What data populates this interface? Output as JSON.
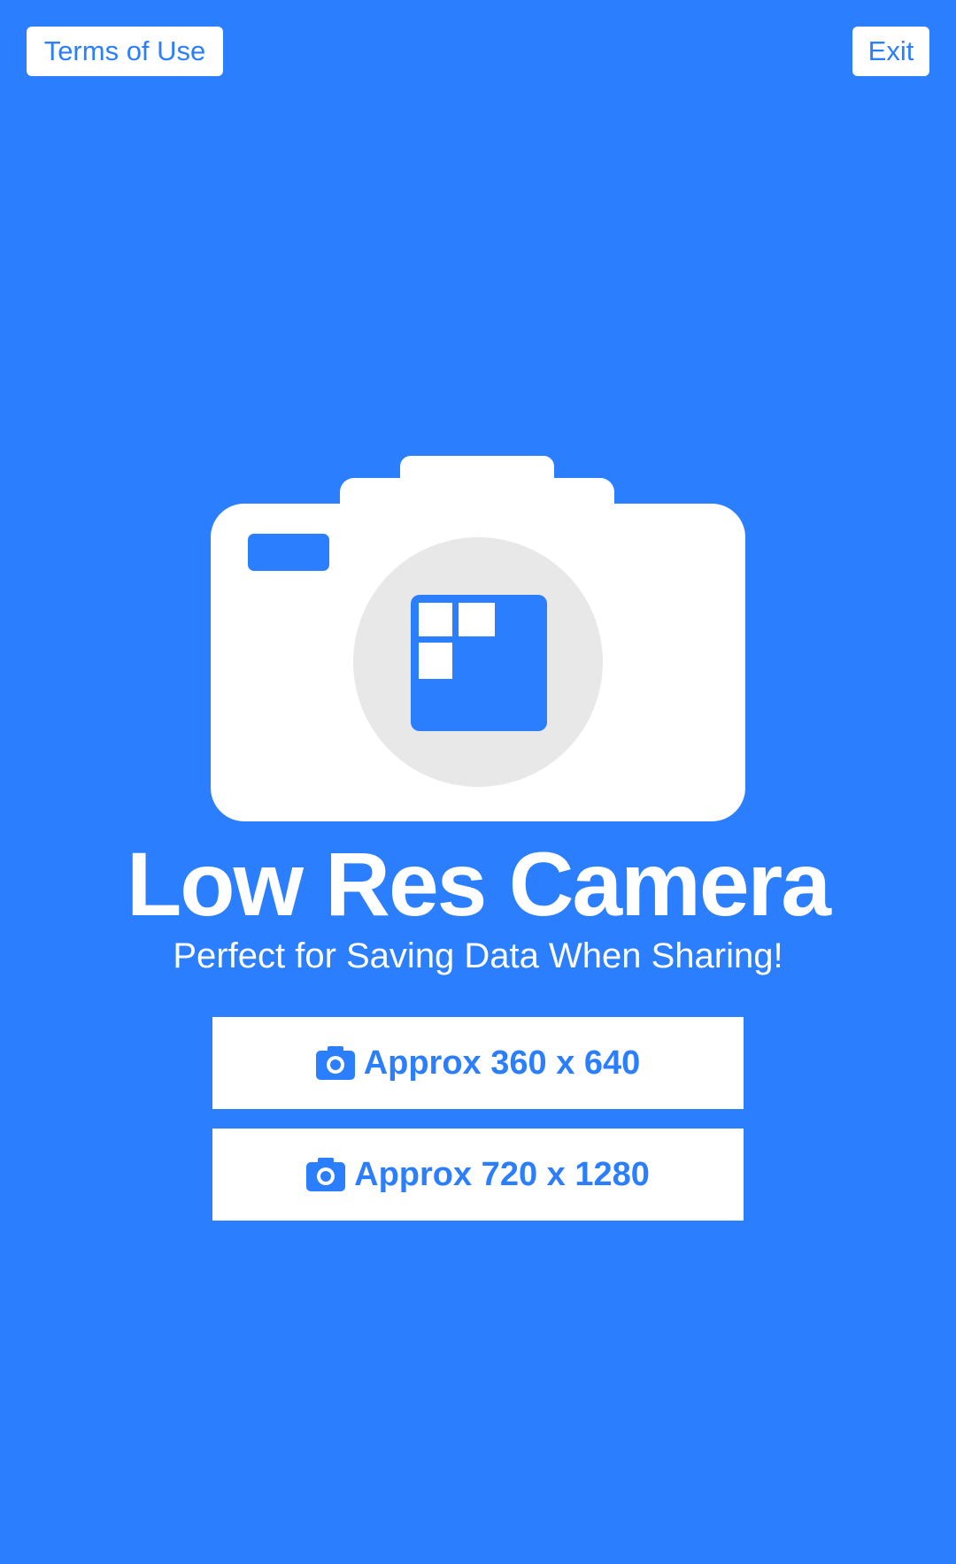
{
  "header": {
    "terms_label": "Terms of Use",
    "exit_label": "Exit"
  },
  "hero": {
    "logo_icon": "camera-icon",
    "title": "Low Res Camera",
    "subtitle": "Perfect for Saving Data When Sharing!"
  },
  "options": [
    {
      "label": "Approx 360 x 640",
      "icon": "camera-icon"
    },
    {
      "label": "Approx 720 x 1280",
      "icon": "camera-icon"
    }
  ],
  "colors": {
    "background": "#2b7fff",
    "foreground": "#ffffff",
    "lens": "#e8e8e8"
  }
}
